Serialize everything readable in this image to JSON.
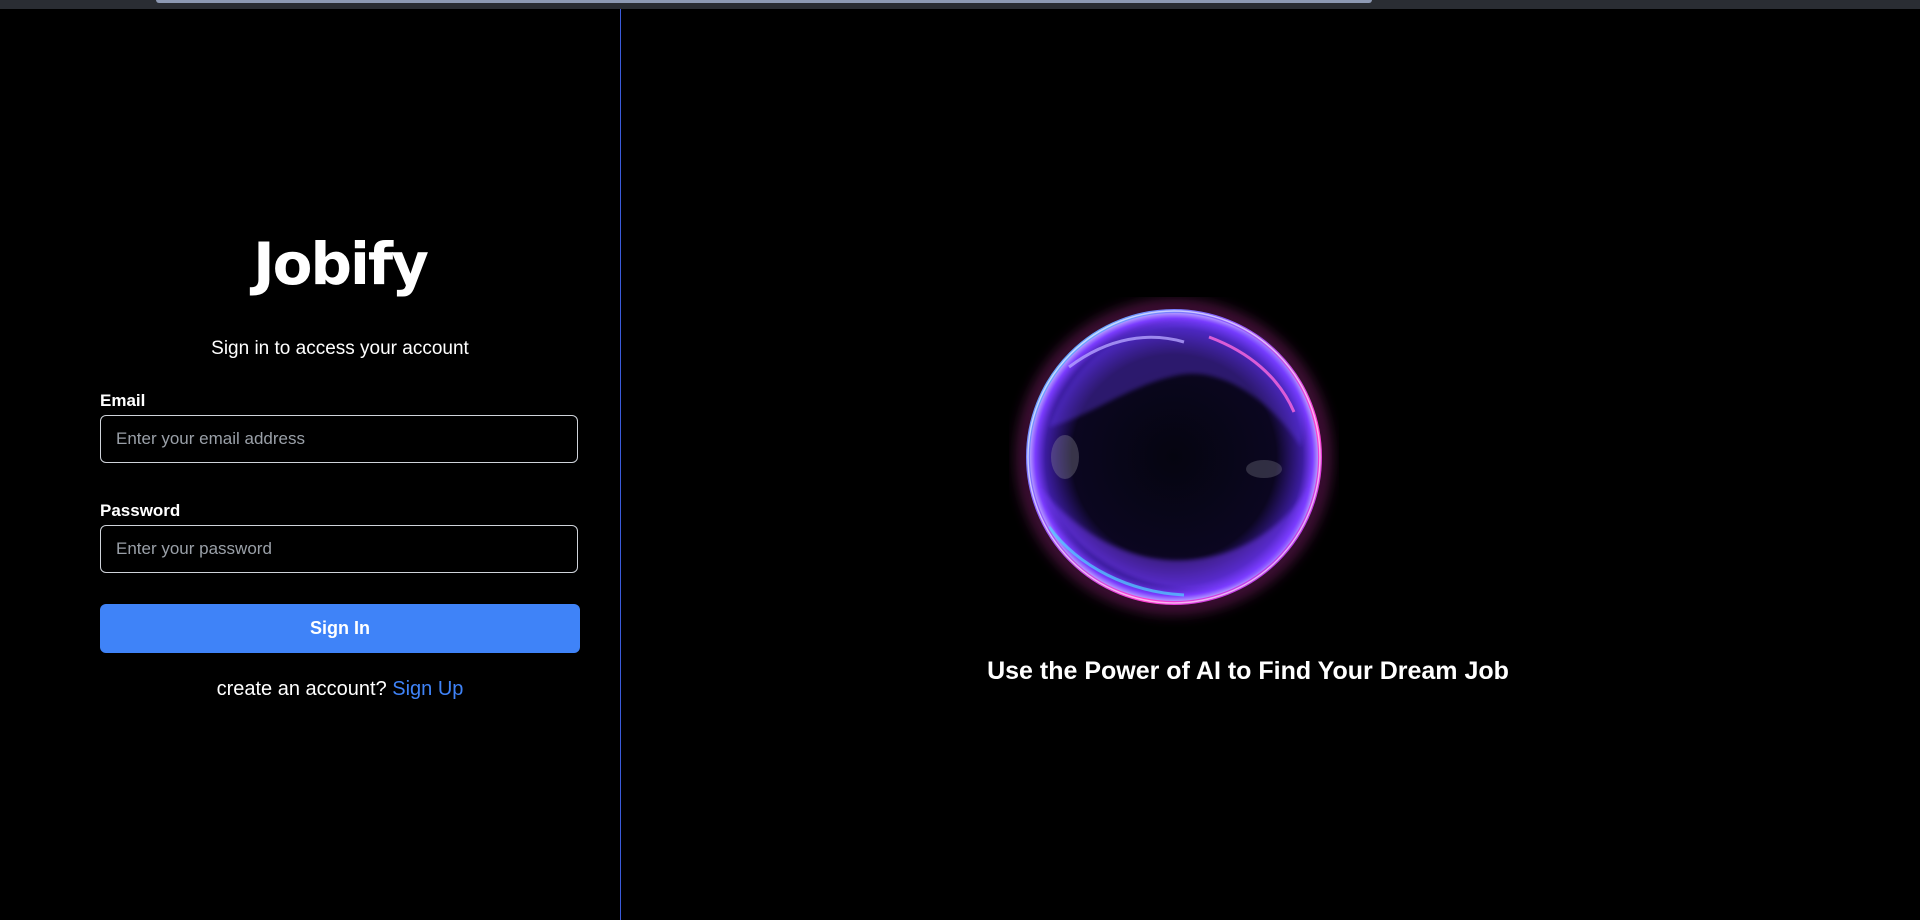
{
  "brand": {
    "name": "Jobify"
  },
  "login": {
    "subtitle": "Sign in to access your account",
    "email_label": "Email",
    "email_placeholder": "Enter your email address",
    "password_label": "Password",
    "password_placeholder": "Enter your password",
    "sign_in_label": "Sign In",
    "signup_prompt": "create an account?",
    "signup_link": "Sign Up"
  },
  "hero": {
    "tagline": "Use the Power of AI to Find Your Dream Job",
    "orb_icon": "glowing-sphere"
  },
  "colors": {
    "background": "#000000",
    "accent": "#3f83f8",
    "divider": "#3b5bdb",
    "orb_purple": "#7b3cff",
    "orb_pink": "#ff3fd2",
    "orb_cyan": "#4fd6ff"
  }
}
